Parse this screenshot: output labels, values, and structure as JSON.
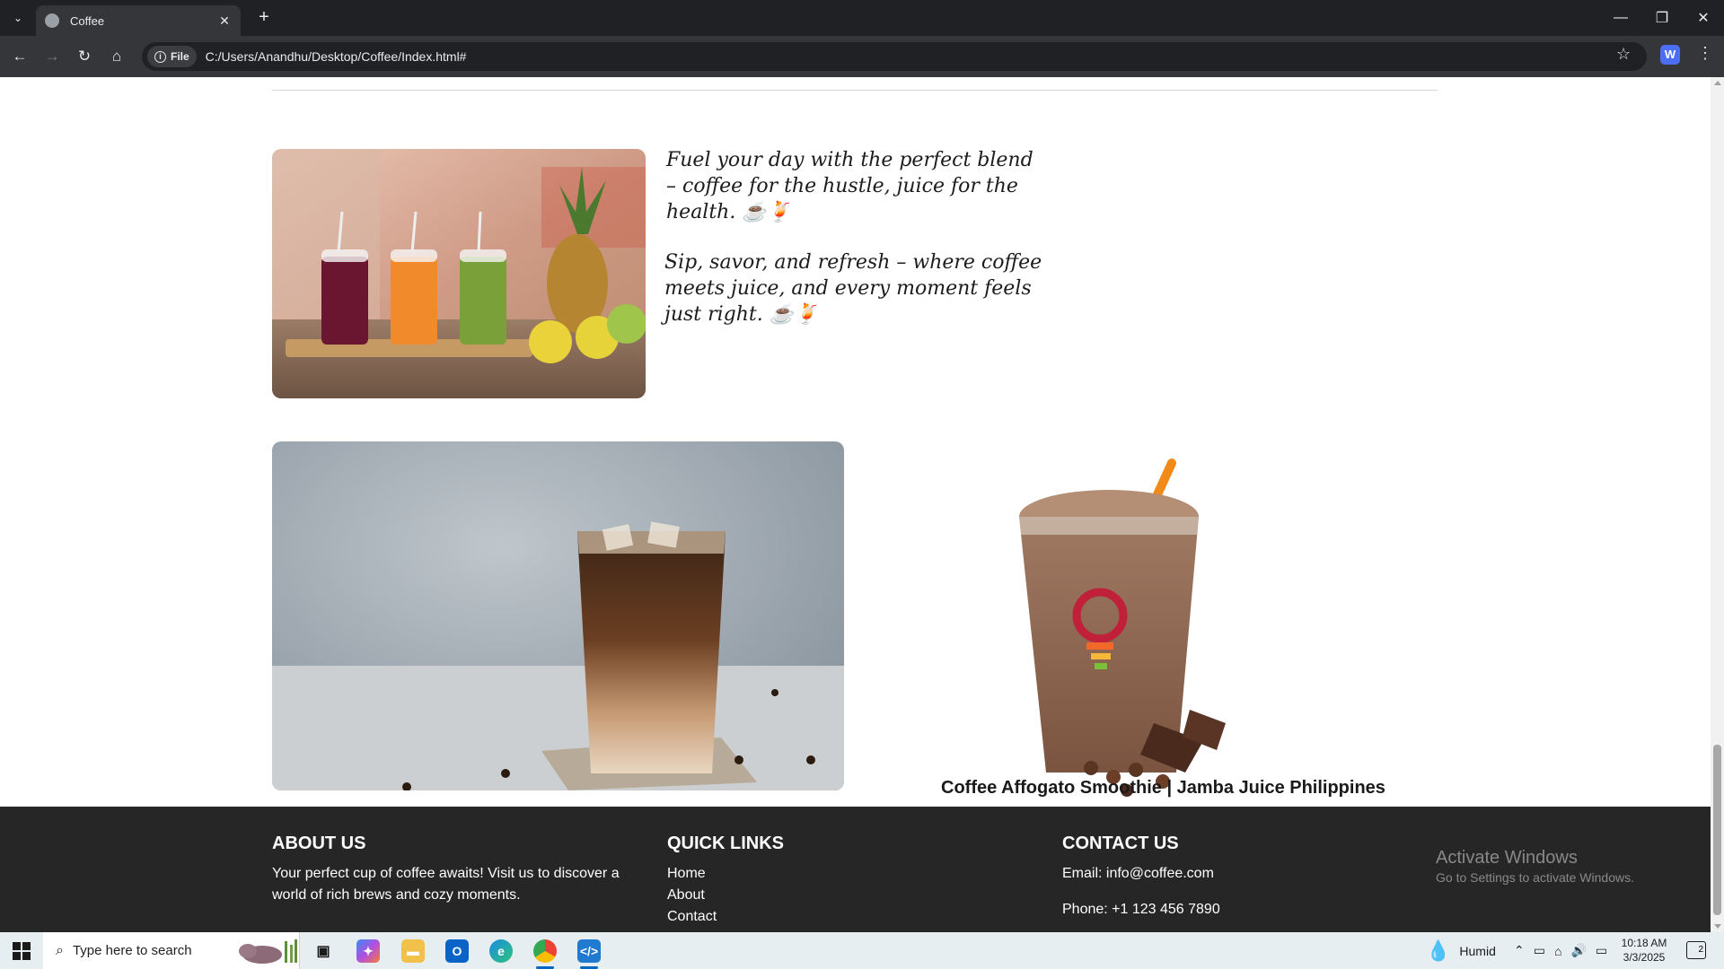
{
  "browser": {
    "tab_title": "Coffee",
    "url_scheme_label": "File",
    "url": "C:/Users/Anandhu/Desktop/Coffee/Index.html#"
  },
  "content": {
    "quote1": "Fuel your day with the perfect blend – coffee for the hustle, juice for the health. ☕🍹",
    "quote2": "Sip, savor, and refresh – where coffee meets juice, and every moment feels just right. ☕🍹",
    "smoothie_caption": "Coffee Affogato Smoothie | Jamba Juice Philippines"
  },
  "footer": {
    "about_heading": "ABOUT US",
    "about_text": "Your perfect cup of coffee awaits! Visit us to discover a world of rich brews and cozy moments.",
    "links_heading": "QUICK LINKS",
    "links": [
      "Home",
      "About",
      "Contact"
    ],
    "contact_heading": "CONTACT US",
    "email": "Email: info@coffee.com",
    "phone": "Phone: +1 123 456 7890"
  },
  "watermark": {
    "line1": "Activate Windows",
    "line2": "Go to Settings to activate Windows."
  },
  "taskbar": {
    "search_placeholder": "Type here to search",
    "weather": "Humid",
    "time": "10:18 AM",
    "date": "3/3/2025",
    "notification_count": "2"
  },
  "colors": {
    "footer_bg": "#262626",
    "chrome_dark": "#202124",
    "chrome_toolbar": "#35363a",
    "taskbar_bg": "#e6eef2"
  }
}
